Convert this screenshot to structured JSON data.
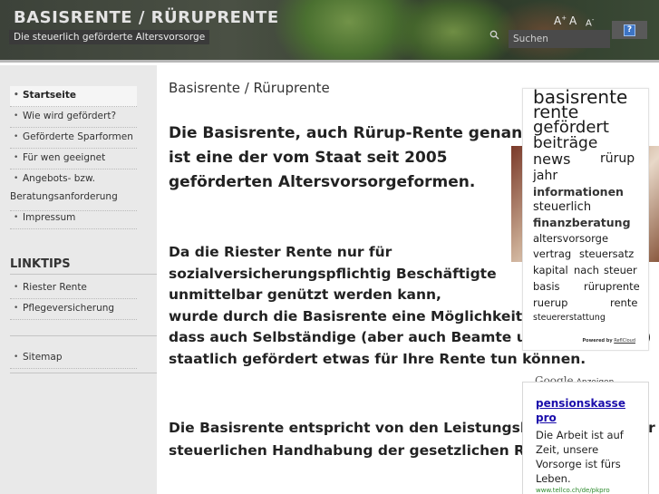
{
  "header": {
    "title": "BASISRENTE / RÜRUPRENTE",
    "subtitle": "Die steuerlich geförderte Altersvorsorge",
    "font_size_large": "A",
    "font_size_medium": "A",
    "font_size_small": "A",
    "search_placeholder": "Suchen",
    "search_button_glyph": "?"
  },
  "sidebar": {
    "nav": [
      {
        "label": "Startseite",
        "active": true
      },
      {
        "label": "Wie wird gefördert?"
      },
      {
        "label": "Geförderte Sparformen"
      },
      {
        "label": "Für wen geeignet"
      },
      {
        "label_line1": "Angebots- bzw.",
        "label_line2": "Beratungsanforderung"
      },
      {
        "label": "Impressum"
      }
    ],
    "linktips_heading": "LINKTIPS",
    "linktips": [
      {
        "label": "Riester Rente"
      },
      {
        "label": "Pflegeversicherung"
      }
    ],
    "extra": [
      {
        "label": "Sitemap"
      }
    ]
  },
  "main": {
    "title": "Basisrente / Rüruprente",
    "p1": [
      "Die Basisrente, auch Rürup-Rente genannt,",
      "ist eine der vom Staat seit 2005",
      "geförderten Altersvorsorgeformen."
    ],
    "p2": [
      "Da die Riester Rente nur für",
      "sozialversicherungspflichtig Beschäftigte",
      "unmittelbar genützt werden kann,",
      "wurde durch die Basisrente eine Möglichkeit geschaffen,",
      "dass auch Selbständige (aber auch Beamte und Freiberufler)",
      "staatlich gefördert etwas für Ihre Rente tun können."
    ],
    "p3": [
      "Die Basisrente entspricht von den Leistungskriterien und der",
      "steuerlichen Handhabung der gesetzlichen Rente."
    ]
  },
  "tagcloud": {
    "tags": [
      "basisrente",
      "rente",
      "gefördert",
      "beiträge",
      "news",
      "rürup",
      "jahr",
      "informationen",
      "steuerlich",
      "finanzberatung",
      "altersvorsorge",
      "vertrag",
      "steuersatz",
      "kapital",
      "nach",
      "steuer",
      "basis",
      "rüruprente",
      "ruerup",
      "rente",
      "steuererstattung"
    ],
    "credit_prefix": "Powered by",
    "credit_link": "ReflCloud"
  },
  "ads": {
    "brand": "Google",
    "label": "-Anzeigen",
    "title": "pensionskasse pro",
    "text": "Die Arbeit ist auf Zeit, unsere Vorsorge ist fürs Leben.",
    "url": "www.tellco.ch/de/pkpro"
  },
  "colors": {
    "header_bg": "#3c4239",
    "sidebar_bg": "#e9e9e9",
    "ad_link": "#1a0dab",
    "ad_url": "#2e8b2e"
  }
}
